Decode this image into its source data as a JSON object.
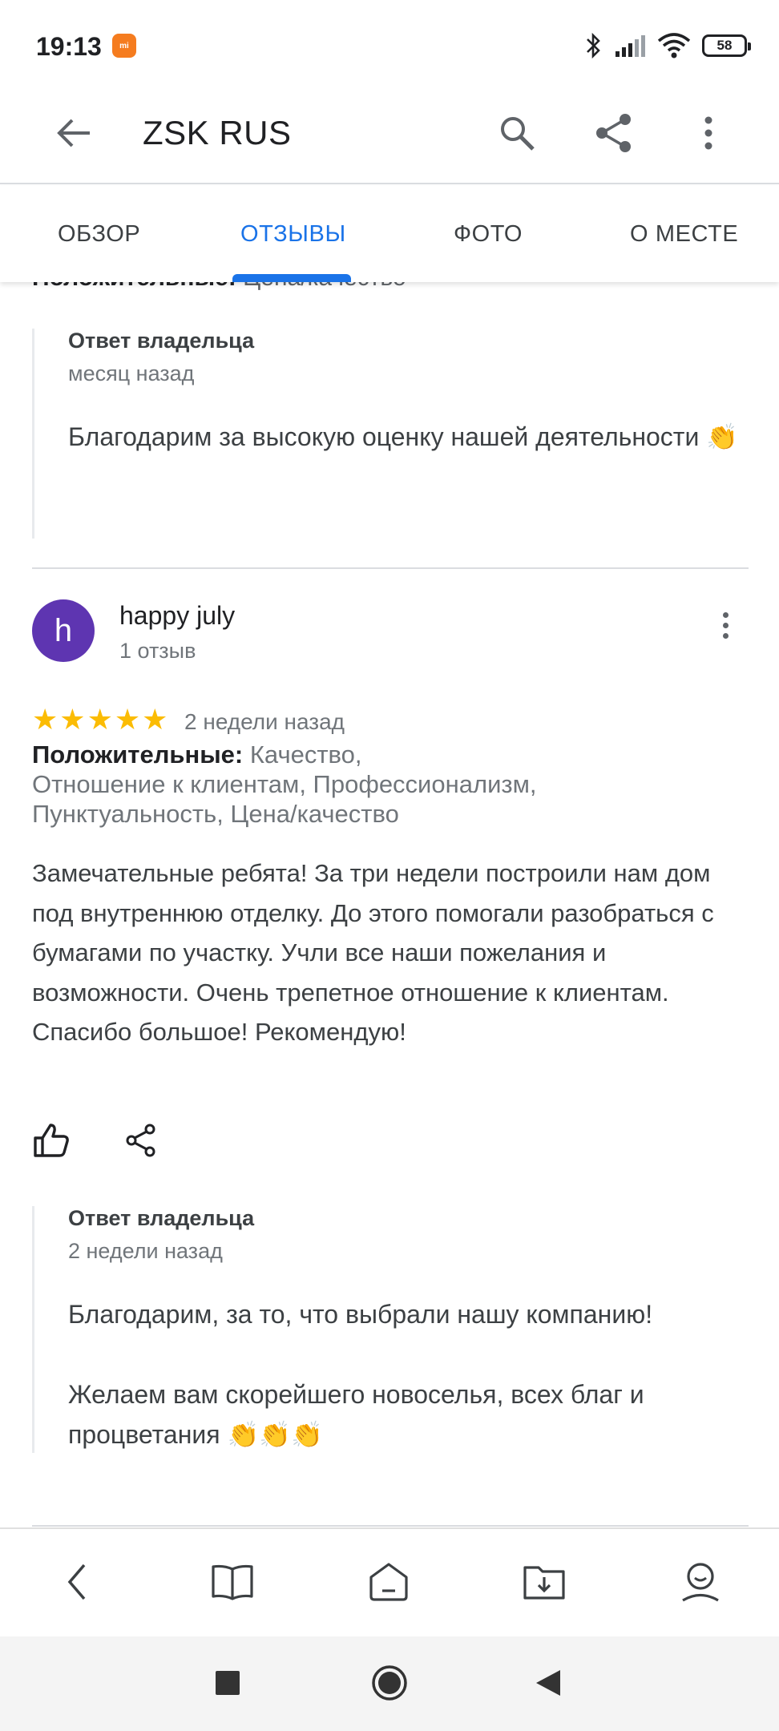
{
  "status_bar": {
    "time": "19:13",
    "app_badge": "mi",
    "battery": "58",
    "icons": [
      "bluetooth-icon",
      "signal-icon",
      "wifi-icon",
      "battery-icon"
    ]
  },
  "app_bar": {
    "title": "ZSK RUS",
    "icons": [
      "back-arrow-icon",
      "search-icon",
      "share-icon",
      "more-vert-icon"
    ]
  },
  "tabs": [
    {
      "label": "ОБЗОР",
      "active": false
    },
    {
      "label": "ОТЗЫВЫ",
      "active": true
    },
    {
      "label": "ФОТО",
      "active": false
    },
    {
      "label": "О МЕСТЕ",
      "active": false
    }
  ],
  "previous_review": {
    "cut_line_bold": "Положительные:",
    "cut_line_rest": " Цена/качество",
    "owner_reply": {
      "title": "Ответ владельца",
      "time": "месяц назад",
      "text": "Благодарим за высокую оценку нашей деятельности 👏"
    }
  },
  "review": {
    "avatar_letter": "h",
    "avatar_color": "#5e35b1",
    "name": "happy july",
    "reviews_count": "1 отзыв",
    "rating": 5,
    "date": "2 недели назад",
    "attributes_label": "Положительные:",
    "attributes_line1": " Качество,",
    "attributes_line2": " Отношение к клиентам, Профессионализм,",
    "attributes_line3": " Пунктуальность, Цена/качество",
    "text": "Замечательные ребята! За три недели построили нам дом под внутреннюю отделку. До этого помогали разобраться с бумагами по участку. Учли все наши пожелания и возможности. Очень трепетное отношение к клиентам. Спасибо большое! Рекомендую!",
    "owner_reply": {
      "title": "Ответ владельца",
      "time": "2 недели назад",
      "text_line1": "Благодарим, за то, что выбрали нашу компанию!",
      "text_line2": "Желаем вам скорейшего новоселья, всех благ и процветания 👏👏👏"
    }
  },
  "bottom_nav": [
    "back-chevron-icon",
    "book-icon",
    "home-icon",
    "download-folder-icon",
    "profile-icon"
  ],
  "system_nav": [
    "recents-square-icon",
    "home-circle-icon",
    "back-triangle-icon"
  ],
  "colors": {
    "accent": "#1a73e8",
    "star": "#fbbc04",
    "text_primary": "#202124",
    "text_secondary": "#70757a"
  }
}
